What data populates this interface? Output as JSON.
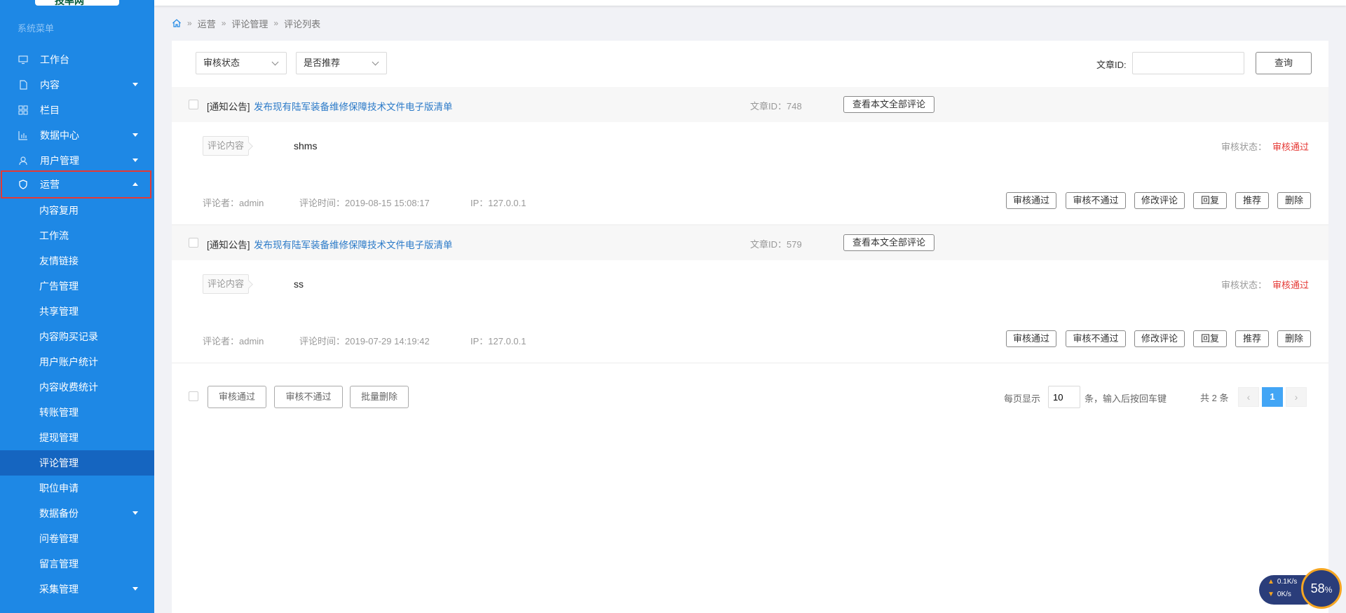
{
  "sidebar": {
    "logo_text": "技率网",
    "menu_title": "系统菜单",
    "items": [
      {
        "label": "工作台"
      },
      {
        "label": "内容"
      },
      {
        "label": "栏目"
      },
      {
        "label": "数据中心"
      },
      {
        "label": "用户管理"
      },
      {
        "label": "运营"
      }
    ],
    "sub_items": [
      {
        "label": "内容复用"
      },
      {
        "label": "工作流"
      },
      {
        "label": "友情链接"
      },
      {
        "label": "广告管理"
      },
      {
        "label": "共享管理"
      },
      {
        "label": "内容购买记录"
      },
      {
        "label": "用户账户统计"
      },
      {
        "label": "内容收费统计"
      },
      {
        "label": "转账管理"
      },
      {
        "label": "提现管理"
      },
      {
        "label": "评论管理"
      },
      {
        "label": "职位申请"
      },
      {
        "label": "数据备份"
      },
      {
        "label": "问卷管理"
      },
      {
        "label": "留言管理"
      },
      {
        "label": "采集管理"
      }
    ]
  },
  "breadcrumb": {
    "items": [
      "运营",
      "评论管理",
      "评论列表"
    ]
  },
  "filters": {
    "audit_status": "审核状态",
    "recommend": "否推荐",
    "recommend_prefix": "是",
    "article_id_label": "文章ID:",
    "article_id_value": "",
    "query_button": "查询"
  },
  "comments": [
    {
      "tag": "[通知公告]",
      "title": "发布现有陆军装备维修保障技术文件电子版清单",
      "article_id": "文章ID：748",
      "view_all": "查看本文全部评论",
      "content_label": "评论内容",
      "content": "shms",
      "status_label": "审核状态：",
      "status_value": "审核通过",
      "commenter": "评论者：admin",
      "time": "评论时间：2019-08-15 15:08:17",
      "ip": "IP：127.0.0.1"
    },
    {
      "tag": "[通知公告]",
      "title": "发布现有陆军装备维修保障技术文件电子版清单",
      "article_id": "文章ID：579",
      "view_all": "查看本文全部评论",
      "content_label": "评论内容",
      "content": "ss",
      "status_label": "审核状态：",
      "status_value": "审核通过",
      "commenter": "评论者：admin",
      "time": "评论时间：2019-07-29 14:19:42",
      "ip": "IP：127.0.0.1"
    }
  ],
  "row_actions": {
    "approve": "审核通过",
    "reject": "审核不通过",
    "edit": "修改评论",
    "reply": "回复",
    "recommend": "推荐",
    "delete": "删除"
  },
  "bulk_actions": {
    "approve": "审核通过",
    "reject": "审核不通过",
    "delete": "批量删除"
  },
  "pagination": {
    "per_page_label": "每页显示",
    "per_page_value": "10",
    "per_page_suffix": "条，输入后按回车键",
    "total": "共 2 条",
    "prev": "‹",
    "current": "1",
    "next": "›"
  },
  "net_widget": {
    "up": "0.1",
    "up_unit": "K/s",
    "down": "0",
    "down_unit": "K/s",
    "percent": "58",
    "percent_sign": "%"
  },
  "colors": {
    "sidebar_bg": "#1e88e5",
    "selected_bg": "#1565c0",
    "link": "#2b7ac8",
    "status_ok": "#e53935",
    "page_active": "#42a5f5"
  }
}
